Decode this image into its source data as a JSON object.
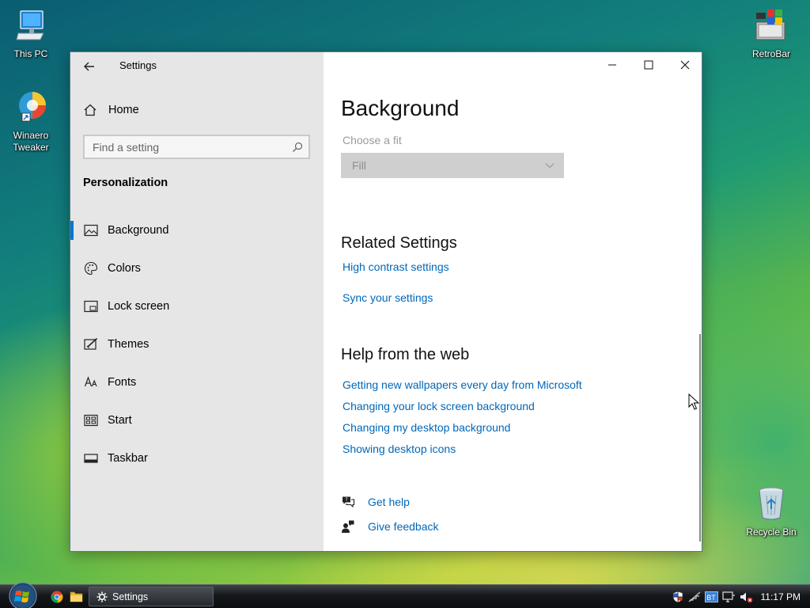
{
  "desktop": {
    "icons": [
      {
        "label": "This PC",
        "icon": "computer-icon"
      },
      {
        "label": "Winaero\nTweaker",
        "label_line1": "Winaero",
        "label_line2": "Tweaker",
        "icon": "winaero-tweaker-icon"
      },
      {
        "label": "RetroBar",
        "icon": "retrobar-icon"
      },
      {
        "label": "Recycle Bin",
        "icon": "recycle-bin-icon"
      }
    ]
  },
  "window": {
    "title": "Settings",
    "nav": {
      "home_label": "Home",
      "search_placeholder": "Find a setting",
      "section_title": "Personalization",
      "items": [
        {
          "label": "Background",
          "icon": "picture-icon",
          "selected": true
        },
        {
          "label": "Colors",
          "icon": "palette-icon",
          "selected": false
        },
        {
          "label": "Lock screen",
          "icon": "lock-screen-icon",
          "selected": false
        },
        {
          "label": "Themes",
          "icon": "themes-icon",
          "selected": false
        },
        {
          "label": "Fonts",
          "icon": "fonts-icon",
          "selected": false
        },
        {
          "label": "Start",
          "icon": "start-icon",
          "selected": false
        },
        {
          "label": "Taskbar",
          "icon": "taskbar-icon",
          "selected": false
        }
      ]
    },
    "content": {
      "page_title": "Background",
      "fit_label": "Choose a fit",
      "fit_value": "Fill",
      "related_title": "Related Settings",
      "related_links": [
        "High contrast settings",
        "Sync your settings"
      ],
      "help_title": "Help from the web",
      "help_links": [
        "Getting new wallpapers every day from Microsoft",
        "Changing your lock screen background",
        "Changing my desktop background",
        "Showing desktop icons"
      ],
      "get_help": "Get help",
      "give_feedback": "Give feedback"
    },
    "colors": {
      "accent": "#0078d7",
      "link": "#0067b8",
      "nav_bg": "#e6e6e6"
    }
  },
  "taskbar": {
    "task_label": "Settings",
    "clock": "11:17 PM",
    "tray_badge": "BT"
  }
}
